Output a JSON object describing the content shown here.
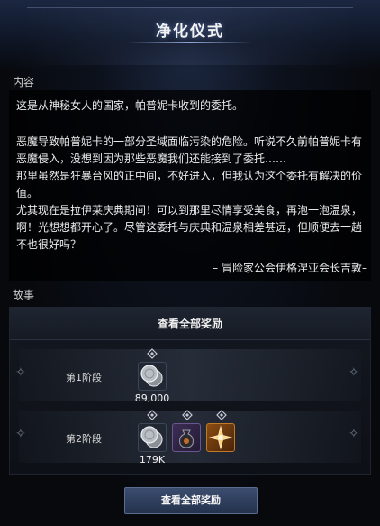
{
  "window": {
    "title": "净化仪式"
  },
  "content": {
    "label": "内容",
    "paragraphs": [
      "这是从神秘女人的国家，帕普妮卡收到的委托。",
      "恶魔导致帕普妮卡的一部分圣域面临污染的危险。听说不久前帕普妮卡有恶魔侵入，没想到因为那些恶魔我们还能接到了委托……",
      "那里虽然是狂暴台风的正中间，不好进入，但我认为这个委托有解决的价值。",
      "尤其现在是拉伊莱庆典期间！可以到那里尽情享受美食，再泡一泡温泉，啊！光想想都开心了。尽管这委托与庆典和温泉相差甚远，但顺便去一趟不也很好吗？"
    ],
    "signature": "– 冒险家公会伊格涅亚会长吉敦–"
  },
  "story": {
    "label": "故事",
    "rewards_header": "查看全部奖励",
    "stages": [
      {
        "label": "第1阶段",
        "items": [
          {
            "icon": "silver-coin-icon",
            "amount": "89,000"
          }
        ]
      },
      {
        "label": "第2阶段",
        "items": [
          {
            "icon": "silver-coin-icon",
            "amount": "179K"
          },
          {
            "icon": "pouch-icon",
            "amount": ""
          },
          {
            "icon": "star-burst-icon",
            "amount": ""
          }
        ]
      }
    ]
  },
  "footer": {
    "view_all_button": "查看全部奖励"
  }
}
